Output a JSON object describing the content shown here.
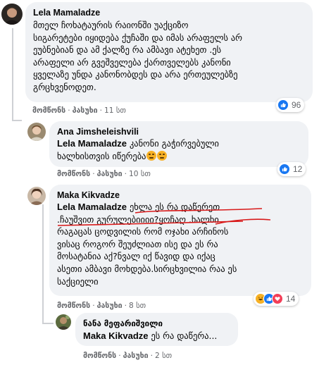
{
  "comments": [
    {
      "author": "Lela Mamaladze",
      "lines": [
        "მთელ ჩოხატაურის რაიონში უაქციზო",
        "სიგარეტები იყიდება ქუჩაში და იმას არაფელს არ",
        "ეუბნებიან და ამ ქალზე რა ამბავი ატეხეთ .ეს",
        "არაფელი არ გვეშველება ქართველებს კანონი",
        "ყველაზე უნდა კანონობდეს და არა ერთეულებზე",
        "გრცხვენოდეთ."
      ],
      "like_label": "მომწონს",
      "reply_label": "პასუხი",
      "time": "11 სთ",
      "reaction_count": "96"
    },
    {
      "author": "Ana Jimsheleishvili",
      "mention": "Lela Mamaladze",
      "lines": [
        "კანონი გაჭირვებული",
        "ხალხისთვის იწერება"
      ],
      "like_label": "მომწონს",
      "reply_label": "პასუხი",
      "time": "10 სთ",
      "reaction_count": "12"
    },
    {
      "author": "Maka Kikvadze",
      "mention": "Lela Mamaladze",
      "lines": [
        "ეხლა ეს რა დაწერეთ",
        ".ჩაუშვით გურულებიიიი?ყოჩაღ .ხალხი",
        "რაგაცას ცოდვილის რომ ოჯახი არჩინოს",
        "ვისაც როგორ შეუძლიათ ისე და ეს რა",
        "მოსატანია აქ?ნვალ იქ წავიდ და იქაც",
        "ასეთი ამბავი მოხდება.სირცხვილია რაა ეს",
        "საქციელი"
      ],
      "like_label": "მომწონს",
      "reply_label": "პასუხი",
      "time": "8 სთ",
      "reaction_count": "14"
    },
    {
      "author": "ნანა მეფარიშვილი",
      "mention": "Maka Kikvadze",
      "lines": [
        "ეს რა დაწერა..."
      ],
      "like_label": "მომწონს",
      "reply_label": "პასუხი",
      "time": "2 სთ"
    }
  ],
  "colors": {
    "bubble": "#f0f2f5",
    "meta_text": "#65676b",
    "like_blue": "#1877f2",
    "love_red": "#f33e58",
    "haha_yellow": "#f7b125",
    "annotation_red": "#d81a1a"
  },
  "icons": {
    "like": "thumbs-up-icon",
    "love": "heart-icon",
    "haha": "laugh-emoji-icon",
    "sad": "sad-emoji-icon"
  }
}
